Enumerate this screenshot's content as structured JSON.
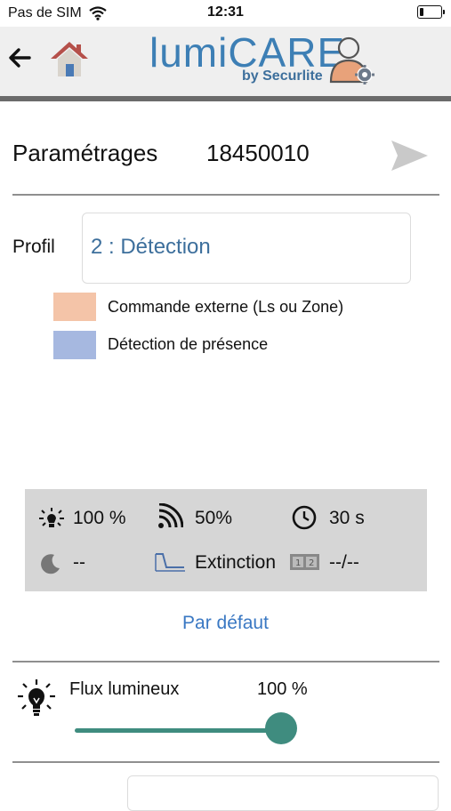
{
  "status_bar": {
    "carrier": "Pas de SIM",
    "time": "12:31"
  },
  "header": {
    "logo_text": "lumiCARE",
    "logo_subtitle": "by Securlite"
  },
  "settings": {
    "title": "Paramétrages",
    "serial": "18450010"
  },
  "profile": {
    "label": "Profil",
    "value": "2 : Détection"
  },
  "legend": [
    {
      "text": "Commande externe (Ls ou Zone)",
      "color": "#f4c4a8"
    },
    {
      "text": "Détection de présence",
      "color": "#a6b8e0"
    }
  ],
  "summary": {
    "brightness": "100 %",
    "sensitivity": "50%",
    "delay": "30 s",
    "night": "--",
    "mode": "Extinction",
    "zones": "--/--"
  },
  "default_link": "Par défaut",
  "flux": {
    "label": "Flux lumineux",
    "value": "100 %",
    "level": 1.0
  },
  "colors": {
    "accent": "#3f8c7f",
    "link": "#3a78c3",
    "brand": "#3d7fb5"
  }
}
